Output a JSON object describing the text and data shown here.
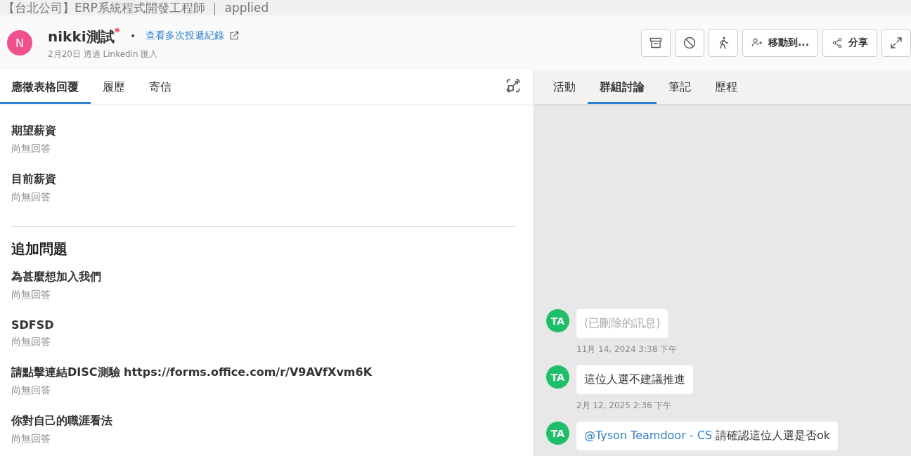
{
  "window": {
    "title": "【台北公司】ERP系統程式開發工程師 ｜ applied"
  },
  "candidate": {
    "initial": "N",
    "name": "nikki測試",
    "required_mark": "*",
    "separator": "•",
    "history_link": "查看多次投遞紀錄",
    "subtitle": "2月20日 透過 Linkedin 匯入"
  },
  "toolbar": [
    {
      "kind": "icon"
    },
    {
      "kind": "icon"
    },
    {
      "kind": "icon"
    },
    {
      "kind": "labeled",
      "label": "移動到..."
    },
    {
      "kind": "labeled",
      "label": "分享"
    },
    {
      "kind": "icon"
    }
  ],
  "left_tabs": [
    {
      "label": "應徵表格回覆",
      "selected": true
    },
    {
      "label": "履歷",
      "selected": false
    },
    {
      "label": "寄信",
      "selected": false
    }
  ],
  "form": [
    {
      "items": [
        {
          "question": "期望薪資",
          "answer": "尚無回答"
        },
        {
          "question": "目前薪資",
          "answer": "尚無回答"
        }
      ]
    },
    {
      "heading": "追加問題",
      "items": [
        {
          "question": "為甚麼想加入我們",
          "answer": "尚無回答"
        },
        {
          "question": "SDFSD",
          "answer": "尚無回答"
        },
        {
          "question": "請點擊連結DISC測驗 https://forms.office.com/r/V9AVfXvm6K",
          "answer": "尚無回答"
        },
        {
          "question": "你對自己的職涯看法",
          "answer": "尚無回答"
        }
      ]
    }
  ],
  "right_tabs": [
    {
      "label": "活動",
      "selected": false
    },
    {
      "label": "群組討論",
      "selected": true
    },
    {
      "label": "筆記",
      "selected": false
    },
    {
      "label": "歷程",
      "selected": false
    }
  ],
  "messages": [
    {
      "kind": "deleted",
      "avatar": "TA",
      "text": "(已刪除的訊息)",
      "time": "11月 14, 2024 3:38 下午"
    },
    {
      "kind": "text",
      "avatar": "TA",
      "text": "這位人選不建議推進",
      "time": "2月 12, 2025 2:36 下午"
    },
    {
      "kind": "mention",
      "avatar": "TA",
      "mention": "@Tyson Teamdoor - CS",
      "text": "請確認這位人選是否ok"
    }
  ]
}
